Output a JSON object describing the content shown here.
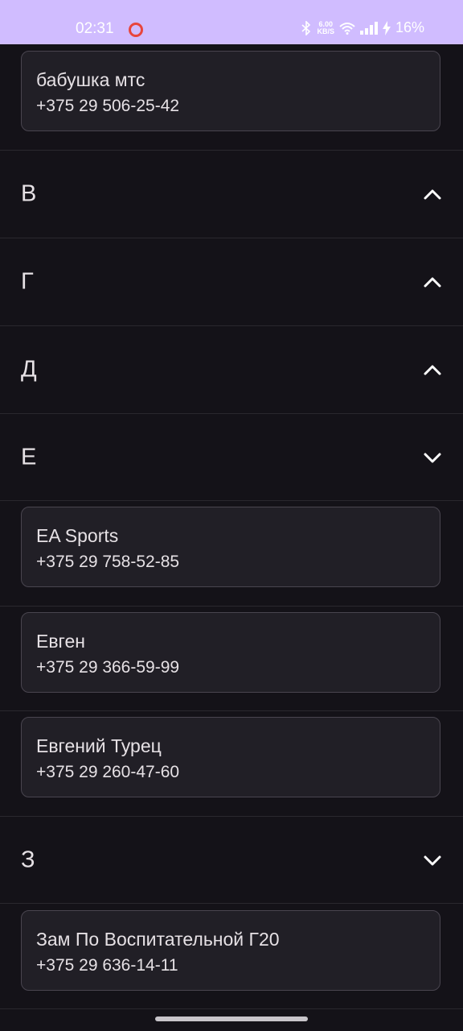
{
  "status_bar": {
    "time": "02:31",
    "net_speed_value": "6.00",
    "net_speed_unit": "KB/S",
    "battery": "16%",
    "icons": [
      "recording-icon",
      "bluetooth-icon",
      "wifi-icon",
      "signal-icon",
      "charging-icon"
    ]
  },
  "contacts_top": [
    {
      "name": "бабушка мтс",
      "phone": "+375 29 506-25-42"
    }
  ],
  "sections": [
    {
      "letter": "В",
      "state": "collapsed",
      "chevron": "chevron-up-icon"
    },
    {
      "letter": "Г",
      "state": "collapsed",
      "chevron": "chevron-up-icon"
    },
    {
      "letter": "Д",
      "state": "collapsed",
      "chevron": "chevron-up-icon"
    },
    {
      "letter": "Е",
      "state": "expanded",
      "chevron": "chevron-down-icon",
      "contacts": [
        {
          "name": "EA Sports",
          "phone": "+375 29 758-52-85"
        },
        {
          "name": "Евген",
          "phone": "+375 29 366-59-99"
        },
        {
          "name": "Евгений Турец",
          "phone": "+375 29 260-47-60"
        }
      ]
    },
    {
      "letter": "З",
      "state": "expanded",
      "chevron": "chevron-down-icon",
      "contacts": [
        {
          "name": "Зам По Воспитательной Г20",
          "phone": "+375 29 636-14-11"
        }
      ]
    }
  ],
  "colors": {
    "background": "#141218",
    "status_bar": "#D0BCFF",
    "card": "#211F26",
    "card_border": "#49454F",
    "text": "#E6E1E5",
    "recording": "#E8453C"
  }
}
